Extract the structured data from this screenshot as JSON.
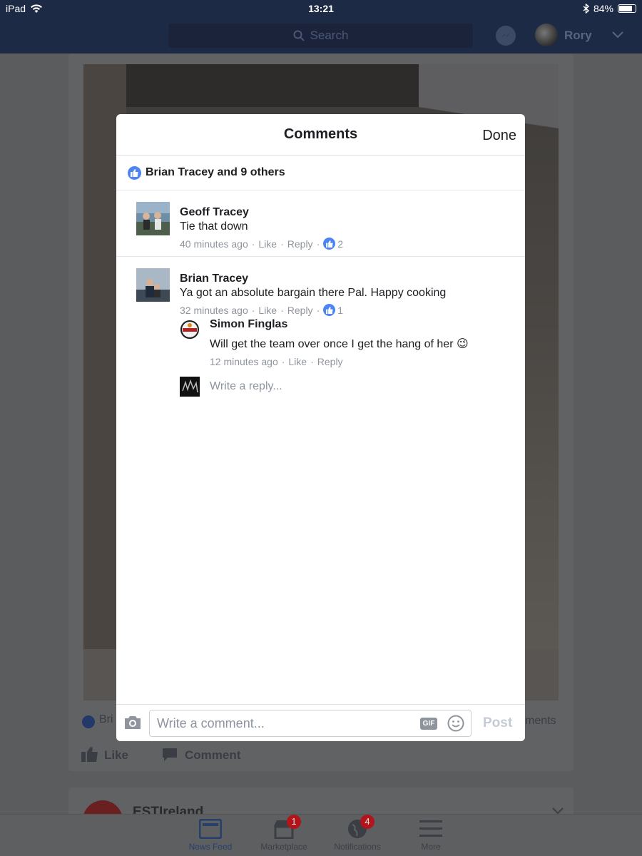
{
  "status_bar": {
    "device": "iPad",
    "time": "13:21",
    "battery": "84%",
    "battery_level": 0.84
  },
  "nav": {
    "search_placeholder": "Search",
    "user_name": "Rory"
  },
  "feed": {
    "reactions_text": "Bri",
    "comments_text": "ments",
    "like_label": "Like",
    "comment_label": "Comment",
    "next_post_page": "ESTIreland"
  },
  "tabs": [
    {
      "label": "News Feed",
      "badge": ""
    },
    {
      "label": "Marketplace",
      "badge": "1"
    },
    {
      "label": "Notifications",
      "badge": "4"
    },
    {
      "label": "More",
      "badge": ""
    }
  ],
  "modal": {
    "title": "Comments",
    "done_label": "Done",
    "likes_summary": "Brian Tracey and 9 others",
    "comments": [
      {
        "name": "Geoff Tracey",
        "text": "Tie that down",
        "time": "40 minutes ago",
        "like": "Like",
        "reply": "Reply",
        "likes": "2"
      },
      {
        "name": "Brian Tracey",
        "text": "Ya got an absolute bargain there Pal.  Happy cooking",
        "time": "32 minutes ago",
        "like": "Like",
        "reply": "Reply",
        "likes": "1",
        "replies": [
          {
            "name": "Simon Finglas",
            "text": "Will get the team over once I get the hang of her 😉",
            "time": "12 minutes ago",
            "like": "Like",
            "reply": "Reply"
          }
        ],
        "reply_placeholder": "Write a reply..."
      }
    ],
    "composer": {
      "placeholder": "Write a comment...",
      "gif_label": "GIF",
      "post_label": "Post"
    }
  },
  "colors": {
    "facebook_blue": "#4c84f3",
    "header_bg": "#1d2a45",
    "badge_red": "#b1141b"
  }
}
